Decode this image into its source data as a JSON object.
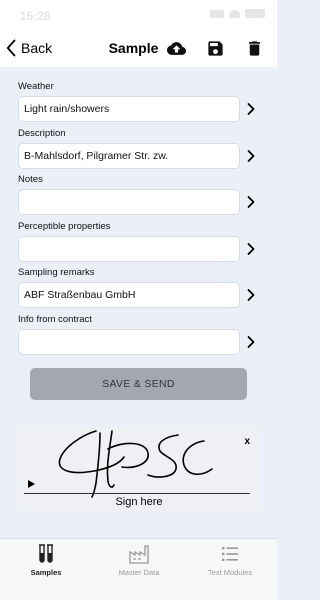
{
  "status_bar": {
    "time": "15:28"
  },
  "nav": {
    "back_label": "Back",
    "title": "Sample"
  },
  "fields": [
    {
      "label": "Weather",
      "value": "Light rain/showers"
    },
    {
      "label": "Description",
      "value": "B-Mahlsdorf, Pilgramer Str. zw."
    },
    {
      "label": "Notes",
      "value": ""
    },
    {
      "label": "Perceptible properties",
      "value": ""
    },
    {
      "label": "Sampling remarks",
      "value": "ABF Straßenbau GmbH"
    },
    {
      "label": "Info from contract",
      "value": ""
    }
  ],
  "save_label": "SAVE & SEND",
  "signature": {
    "clear_label": "x",
    "hint": "Sign here"
  },
  "tabs": [
    {
      "label": "Samples",
      "icon": "test-tubes-icon",
      "active": true
    },
    {
      "label": "Master Data",
      "icon": "factory-icon",
      "active": false
    },
    {
      "label": "Text Modules",
      "icon": "list-icon",
      "active": false
    }
  ]
}
